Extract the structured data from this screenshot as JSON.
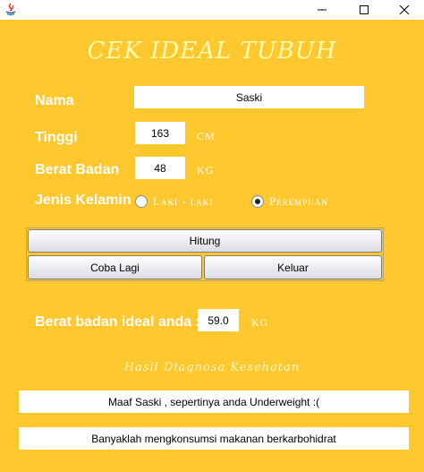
{
  "window": {
    "min_glyph": "—",
    "max_glyph": "☐",
    "close_glyph": "✕"
  },
  "form": {
    "title": "CEK IDEAL TUBUH",
    "nama_label": "Nama",
    "nama_value": "Saski",
    "tinggi_label": "Tinggi",
    "tinggi_value": "163",
    "tinggi_unit": "CM",
    "berat_label": "Berat Badan",
    "berat_value": "48",
    "berat_unit": "KG",
    "gender_label": "Jenis Kelamin",
    "gender_options": [
      "Laki - laki",
      "Perempuan"
    ],
    "gender_selected": "Perempuan"
  },
  "buttons": {
    "hitung": "Hitung",
    "coba_lagi": "Coba Lagi",
    "keluar": "Keluar"
  },
  "result": {
    "label": "Berat badan ideal anda :",
    "value": "59.0",
    "unit": "KG",
    "diagnosis_title": "Hasil Diagnosa Kesehatan",
    "message_1": "Maaf Saski , sepertinya anda Underweight :(",
    "message_2": "Banyaklah mengkonsumsi makanan berkarbohidrat"
  }
}
